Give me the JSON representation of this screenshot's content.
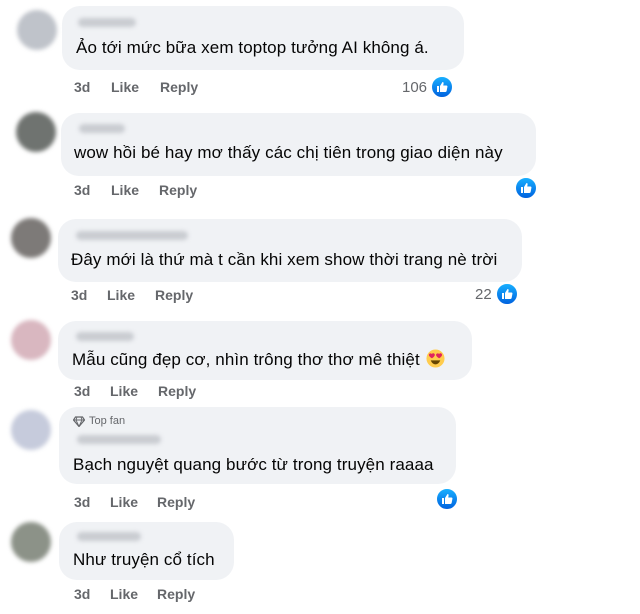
{
  "comments": [
    {
      "avatar_color": "#bfc3ca",
      "text": "Ảo tới mức bữa xem toptop tưởng AI không á.",
      "time": "3d",
      "like_label": "Like",
      "reply_label": "Reply",
      "reaction_count": "106",
      "reaction_icon": "like-icon"
    },
    {
      "avatar_color": "#6f7370",
      "text": "wow hồi bé hay mơ thấy các chị tiên trong giao diện này",
      "time": "3d",
      "like_label": "Like",
      "reply_label": "Reply",
      "reaction_count": "",
      "reaction_icon": "like-icon"
    },
    {
      "avatar_color": "#7d7a78",
      "text": "Đây mới là thứ mà t cần khi xem show thời trang nè trời",
      "time": "3d",
      "like_label": "Like",
      "reply_label": "Reply",
      "reaction_count": "22",
      "reaction_icon": "like-icon"
    },
    {
      "avatar_color": "#d9b7c0",
      "text": "Mẫu cũng đẹp cơ, nhìn trông thơ thơ mê thiệt",
      "emoji": "heart-eyes-emoji",
      "time": "3d",
      "like_label": "Like",
      "reply_label": "Reply"
    },
    {
      "avatar_color": "#c6cbdc",
      "badge": "Top fan",
      "badge_icon": "diamond-icon",
      "text": "Bạch nguyệt quang bước từ trong truyện raaaa",
      "time": "3d",
      "like_label": "Like",
      "reply_label": "Reply",
      "reaction_count": "",
      "reaction_icon": "like-icon"
    },
    {
      "avatar_color": "#8c9288",
      "text": "Như truyện cổ tích",
      "time": "3d",
      "like_label": "Like",
      "reply_label": "Reply"
    }
  ],
  "colors": {
    "bubble": "#f0f2f5",
    "text": "#050505",
    "secondary_text": "#65676b",
    "like_blue": "#1877f2"
  }
}
